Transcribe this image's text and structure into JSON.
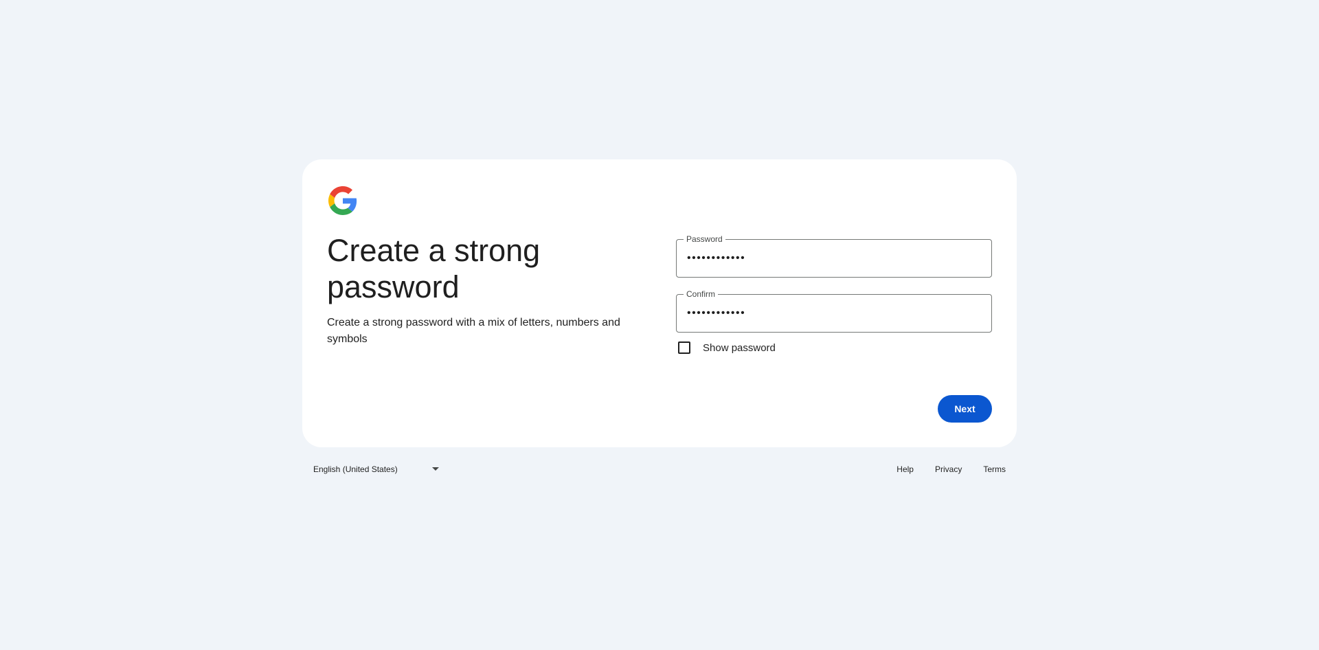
{
  "logo": {
    "icon": "google-g-icon",
    "colors": {
      "red": "#ea4335",
      "yellow": "#fbbc05",
      "green": "#34a853",
      "blue": "#4285f4"
    }
  },
  "main": {
    "title": "Create a strong password",
    "subtitle": "Create a strong password with a mix of letters, numbers and symbols"
  },
  "form": {
    "password": {
      "label": "Password",
      "value": "••••••••••••"
    },
    "confirm": {
      "label": "Confirm",
      "value": "••••••••••••"
    },
    "show_password": {
      "label": "Show password",
      "checked": false
    },
    "next_label": "Next"
  },
  "footer": {
    "language": "English (United States)",
    "links": {
      "help": "Help",
      "privacy": "Privacy",
      "terms": "Terms"
    }
  },
  "colors": {
    "background": "#f0f4f9",
    "card": "#ffffff",
    "primary_button": "#0b57d0"
  }
}
